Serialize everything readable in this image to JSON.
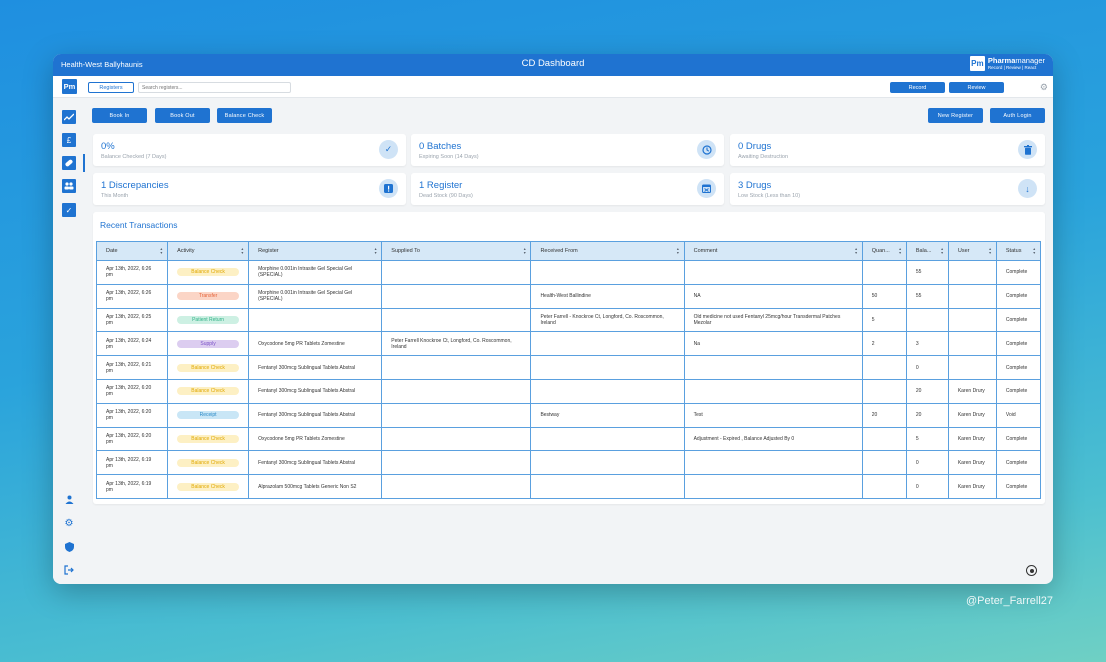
{
  "titlebar": {
    "organisation": "Health-West Ballyhaunis",
    "title": "CD Dashboard",
    "brand_logo": "Pm",
    "brand_name_bold": "Pharma",
    "brand_name_light": "manager",
    "brand_tagline": "Record | Review | React"
  },
  "toolbar": {
    "logo": "Pm",
    "registers_label": "Registers",
    "search_placeholder": "Search registers...",
    "record_label": "Record",
    "review_label": "Review",
    "settings_icon": "gear-icon"
  },
  "sidebar": {
    "items": [
      {
        "name": "trend-icon",
        "glyph": "📈"
      },
      {
        "name": "pound-icon",
        "glyph": "£"
      },
      {
        "name": "pill-icon",
        "glyph": "✎"
      },
      {
        "name": "group-icon",
        "glyph": "👥"
      },
      {
        "name": "check-icon",
        "glyph": "✓"
      }
    ],
    "bottom": [
      {
        "name": "user-icon",
        "glyph": "👤"
      },
      {
        "name": "settings-icon",
        "glyph": "⚙"
      },
      {
        "name": "shield-icon",
        "glyph": "⛨"
      },
      {
        "name": "logout-icon",
        "glyph": "⇥"
      }
    ]
  },
  "actions": {
    "book_in": "Book In",
    "book_out": "Book Out",
    "balance_check": "Balance Check",
    "new_register": "New Register",
    "auth_login": "Auth Login"
  },
  "stats": [
    {
      "value": "0%",
      "label": "Balance Checked (7 Days)",
      "icon": "✓",
      "icon_name": "check-circle-icon"
    },
    {
      "value": "0 Batches",
      "label": "Expiring Soon (14 Days)",
      "icon": "◷",
      "icon_name": "clock-icon"
    },
    {
      "value": "0 Drugs",
      "label": "Awaiting Destruction",
      "icon": "🗑",
      "icon_name": "trash-icon"
    },
    {
      "value": "1 Discrepancies",
      "label": "This Month",
      "icon": "!",
      "icon_name": "alert-icon"
    },
    {
      "value": "1 Register",
      "label": "Dead Stock (90 Days)",
      "icon": "▦",
      "icon_name": "calendar-icon"
    },
    {
      "value": "3 Drugs",
      "label": "Low Stock (Less than 10)",
      "icon": "↓",
      "icon_name": "arrow-down-icon"
    }
  ],
  "transactions": {
    "title": "Recent Transactions",
    "columns": [
      "Date",
      "Activity",
      "Register",
      "Supplied To",
      "Received From",
      "Comment",
      "Quan...",
      "Bala...",
      "User",
      "Status"
    ],
    "activity_colors": {
      "Balance Check": {
        "bg": "#fdf0c4",
        "fg": "#e0a800"
      },
      "Transfer": {
        "bg": "#fbd5c6",
        "fg": "#e5643a"
      },
      "Patient Return": {
        "bg": "#cdf0e3",
        "fg": "#2fb186"
      },
      "Supply": {
        "bg": "#dccdf0",
        "fg": "#7b52c7"
      },
      "Receipt": {
        "bg": "#c9e6f6",
        "fg": "#2b8ac7"
      }
    },
    "rows": [
      {
        "date": "Apr 13th, 2022, 6:26 pm",
        "activity": "Balance Check",
        "register": "Morphine 0.001in Intrasite Gel Special Gel (SPECIAL)",
        "supplied_to": "",
        "received_from": "",
        "comment": "",
        "quantity": "",
        "balance": "55",
        "user": "",
        "status": "Complete"
      },
      {
        "date": "Apr 13th, 2022, 6:26 pm",
        "activity": "Transfer",
        "register": "Morphine 0.001in Intrasite Gel Special Gel (SPECIAL)",
        "supplied_to": "",
        "received_from": "Health-West Ballindine",
        "comment": "NA",
        "quantity": "50",
        "balance": "55",
        "user": "",
        "status": "Complete"
      },
      {
        "date": "Apr 13th, 2022, 6:25 pm",
        "activity": "Patient Return",
        "register": "",
        "supplied_to": "",
        "received_from": "Peter Farrell - Knockroe Ct, Longford, Co. Roscommon, Ireland",
        "comment": "Old medicine not used Fentanyl 25mcg/hour Transdermal Patches Mezolar",
        "quantity": "5",
        "balance": "",
        "user": "",
        "status": "Complete"
      },
      {
        "date": "Apr 13th, 2022, 6:24 pm",
        "activity": "Supply",
        "register": "Oxycodone 5mg PR Tablets Zomestine",
        "supplied_to": "Peter Farrell Knockroe Ct, Longford, Co. Roscommon, Ireland",
        "received_from": "",
        "comment": "Na",
        "quantity": "2",
        "balance": "3",
        "user": "",
        "status": "Complete"
      },
      {
        "date": "Apr 13th, 2022, 6:21 pm",
        "activity": "Balance Check",
        "register": "Fentanyl 300mcg Sublingual Tablets Abstral",
        "supplied_to": "",
        "received_from": "",
        "comment": "",
        "quantity": "",
        "balance": "0",
        "user": "",
        "status": "Complete"
      },
      {
        "date": "Apr 13th, 2022, 6:20 pm",
        "activity": "Balance Check",
        "register": "Fentanyl 300mcg Sublingual Tablets Abstral",
        "supplied_to": "",
        "received_from": "",
        "comment": "",
        "quantity": "",
        "balance": "20",
        "user": "Karen Drury",
        "status": "Complete"
      },
      {
        "date": "Apr 13th, 2022, 6:20 pm",
        "activity": "Receipt",
        "register": "Fentanyl 300mcg Sublingual Tablets Abstral",
        "supplied_to": "",
        "received_from": "Bestway",
        "comment": "Test",
        "quantity": "20",
        "balance": "20",
        "user": "Karen Drury",
        "status": "Void"
      },
      {
        "date": "Apr 13th, 2022, 6:20 pm",
        "activity": "Balance Check",
        "register": "Oxycodone 5mg PR Tablets Zomestine",
        "supplied_to": "",
        "received_from": "",
        "comment": "Adjustment - Expired , Balance Adjusted By 0",
        "quantity": "",
        "balance": "5",
        "user": "Karen Drury",
        "status": "Complete"
      },
      {
        "date": "Apr 13th, 2022, 6:19 pm",
        "activity": "Balance Check",
        "register": "Fentanyl 300mcg Sublingual Tablets Abstral",
        "supplied_to": "",
        "received_from": "",
        "comment": "",
        "quantity": "",
        "balance": "0",
        "user": "Karen Drury",
        "status": "Complete"
      },
      {
        "date": "Apr 13th, 2022, 6:19 pm",
        "activity": "Balance Check",
        "register": "Alprazolam 500mcg Tablets Generic Non S2",
        "supplied_to": "",
        "received_from": "",
        "comment": "",
        "quantity": "",
        "balance": "0",
        "user": "Karen Drury",
        "status": "Complete"
      }
    ]
  },
  "watermark": "@Peter_Farrell27"
}
